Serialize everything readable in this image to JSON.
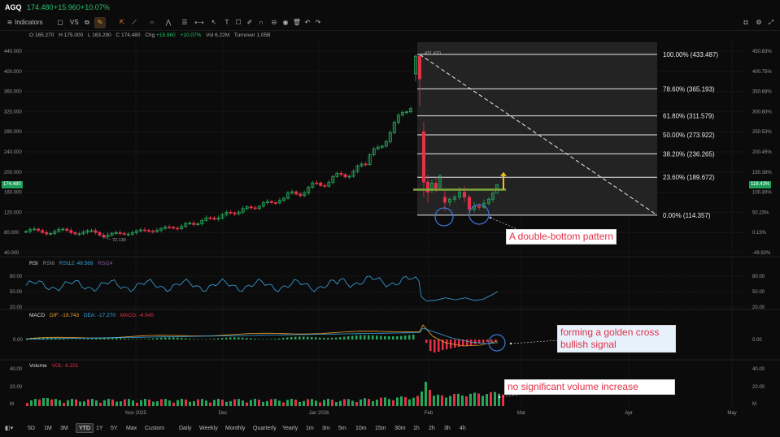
{
  "header": {
    "symbol": "AGQ",
    "price": "174.480",
    "change": "+15.960",
    "change_pct": "+10.07%"
  },
  "toolbar": {
    "indicators_label": "Indicators",
    "vs_label": "VS"
  },
  "ohlc": {
    "o_label": "O",
    "o": "165.270",
    "h_label": "H",
    "h": "175.000",
    "l_label": "L",
    "l": "163.290",
    "c_label": "C",
    "c": "174.480",
    "chg_label": "Chg",
    "chg": "+15.960",
    "chg_pct": "+10.07%",
    "vol_label": "Vol",
    "vol": "6.22M",
    "turnover_label": "Turnover",
    "turnover": "1.05B"
  },
  "price_axis_left": [
    "440.000",
    "400.000",
    "360.000",
    "320.000",
    "280.000",
    "240.000",
    "200.000",
    "160.000",
    "120.000",
    "80.000",
    "40.000"
  ],
  "price_axis_right": [
    "450.83%",
    "400.75%",
    "350.68%",
    "300.60%",
    "250.53%",
    "200.45%",
    "150.38%",
    "100.30%",
    "50.23%",
    "0.15%",
    "-49.92%"
  ],
  "current_price_tag": "174.480",
  "current_pct_tag": "118.43%",
  "low_marker": "72.130",
  "high_marker": "431.470",
  "fib_levels": [
    {
      "label": "100.00% (433.487)",
      "price": 433.487
    },
    {
      "label": "78.60% (365.193)",
      "price": 365.193
    },
    {
      "label": "61.80% (311.579)",
      "price": 311.579
    },
    {
      "label": "50.00% (273.922)",
      "price": 273.922
    },
    {
      "label": "38.20% (236.265)",
      "price": 236.265
    },
    {
      "label": "23.60% (189.672)",
      "price": 189.672
    },
    {
      "label": "0.00% (114.357)",
      "price": 114.357
    }
  ],
  "rsi": {
    "title": "RSI",
    "rsi6_label": "RSI6",
    "rsi12_label": "RSI12: 49.569",
    "rsi24_label": "RSI24",
    "axis_left": [
      "80.00",
      "50.00",
      "20.00"
    ],
    "axis_right": [
      "80.00",
      "50.00",
      "20.00"
    ]
  },
  "macd": {
    "title": "MACD",
    "dif_label": "DIF: -19.743",
    "dea_label": "DEA: -17.270",
    "macd_label": "MACD: -4.945",
    "axis_left": [
      "0.00"
    ],
    "axis_right": [
      "0.00"
    ]
  },
  "volume": {
    "title": "Volume",
    "vol_label": "VOL: 6.221",
    "axis_left": [
      "40.00",
      "20.00",
      "M"
    ],
    "axis_right": [
      "40.00",
      "20.00",
      "M"
    ]
  },
  "time_axis": [
    "Nov 2025",
    "Dec",
    "Jan 2026",
    "Feb",
    "Mar",
    "Apr",
    "May"
  ],
  "annotations": {
    "double_bottom": "A double-bottom pattern",
    "golden_cross": "forming a golden cross\nbullish signal",
    "volume_note": "no significant volume increase"
  },
  "bottom_bar": {
    "ranges": [
      "5D",
      "1M",
      "3M",
      "YTD",
      "1Y",
      "5Y",
      "Max",
      "Custom"
    ],
    "active_range": "YTD",
    "intervals": [
      "Daily",
      "Weekly",
      "Monthly",
      "Quarterly",
      "Yearly",
      "1m",
      "3m",
      "5m",
      "10m",
      "15m",
      "30m",
      "1h",
      "2h",
      "3h",
      "4h"
    ]
  },
  "colors": {
    "up": "#26a65b",
    "down": "#e33148",
    "accent_green": "#1e9e5a",
    "fib_zone": "#2b2b2b",
    "circle": "#3a78d8"
  }
}
